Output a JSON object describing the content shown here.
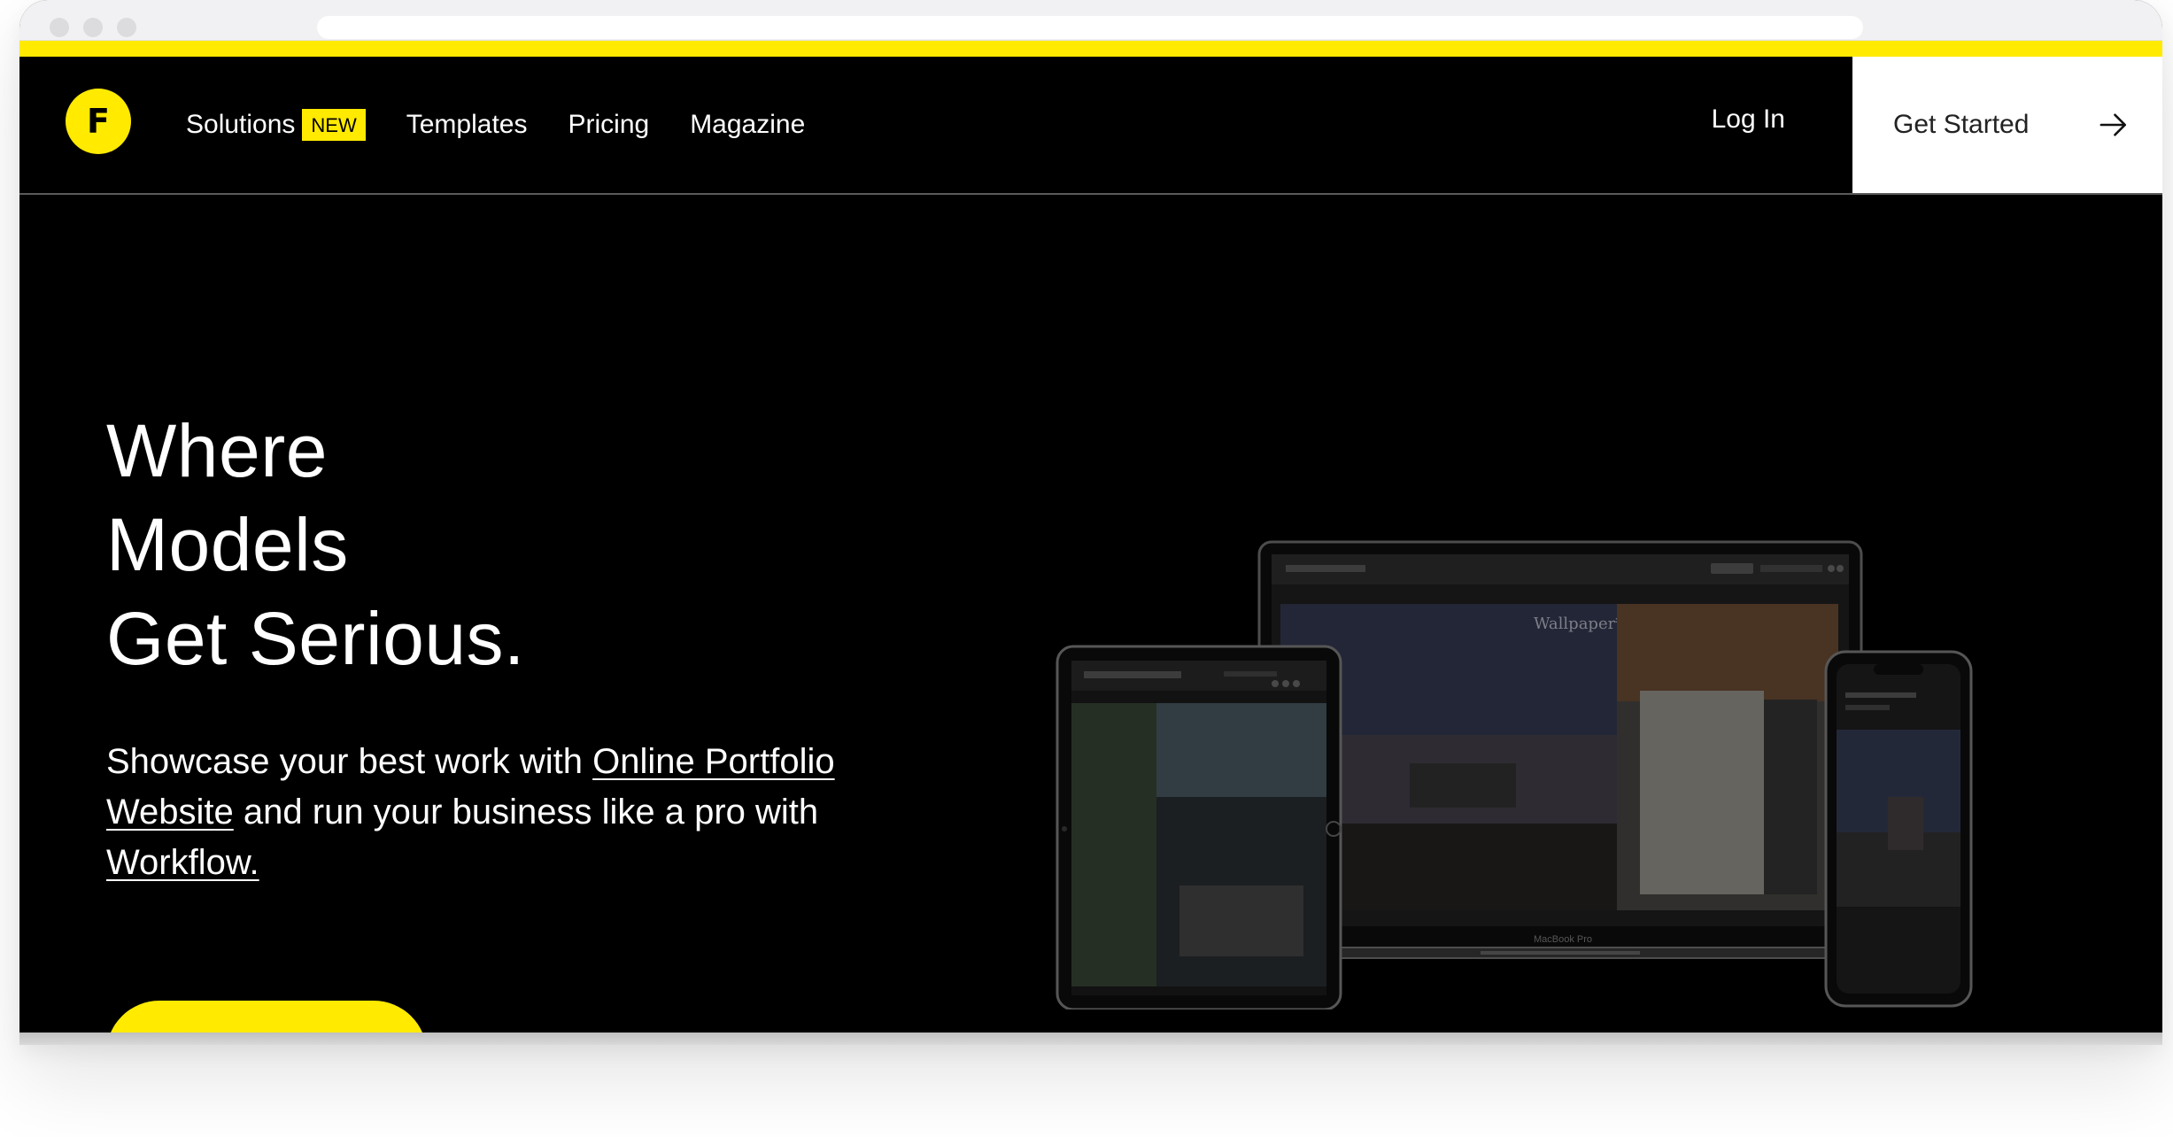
{
  "window": {
    "title": ""
  },
  "header": {
    "logo_letter": "F",
    "nav": [
      {
        "label": "Solutions",
        "badge": "NEW"
      },
      {
        "label": "Templates"
      },
      {
        "label": "Pricing"
      },
      {
        "label": "Magazine"
      }
    ],
    "login_label": "Log In",
    "get_started_label": "Get Started"
  },
  "hero": {
    "title_lines": [
      "Where",
      "Models",
      "Get Serious."
    ],
    "subtitle_intro": "Showcase your best work with ",
    "subtitle_link1": "Online Portfolio Website",
    "subtitle_mid": " and run your business like a pro with ",
    "subtitle_link2": "Workflow.",
    "device_brand_text": "Wallpaper*",
    "laptop_caption": "MacBook Pro"
  },
  "colors": {
    "accent": "#ffea00",
    "background": "#000000",
    "text": "#ffffff",
    "button_bg": "#ffffff"
  },
  "icons": {
    "logo": "format-logo",
    "cta_arrow": "arrow-right-icon"
  }
}
